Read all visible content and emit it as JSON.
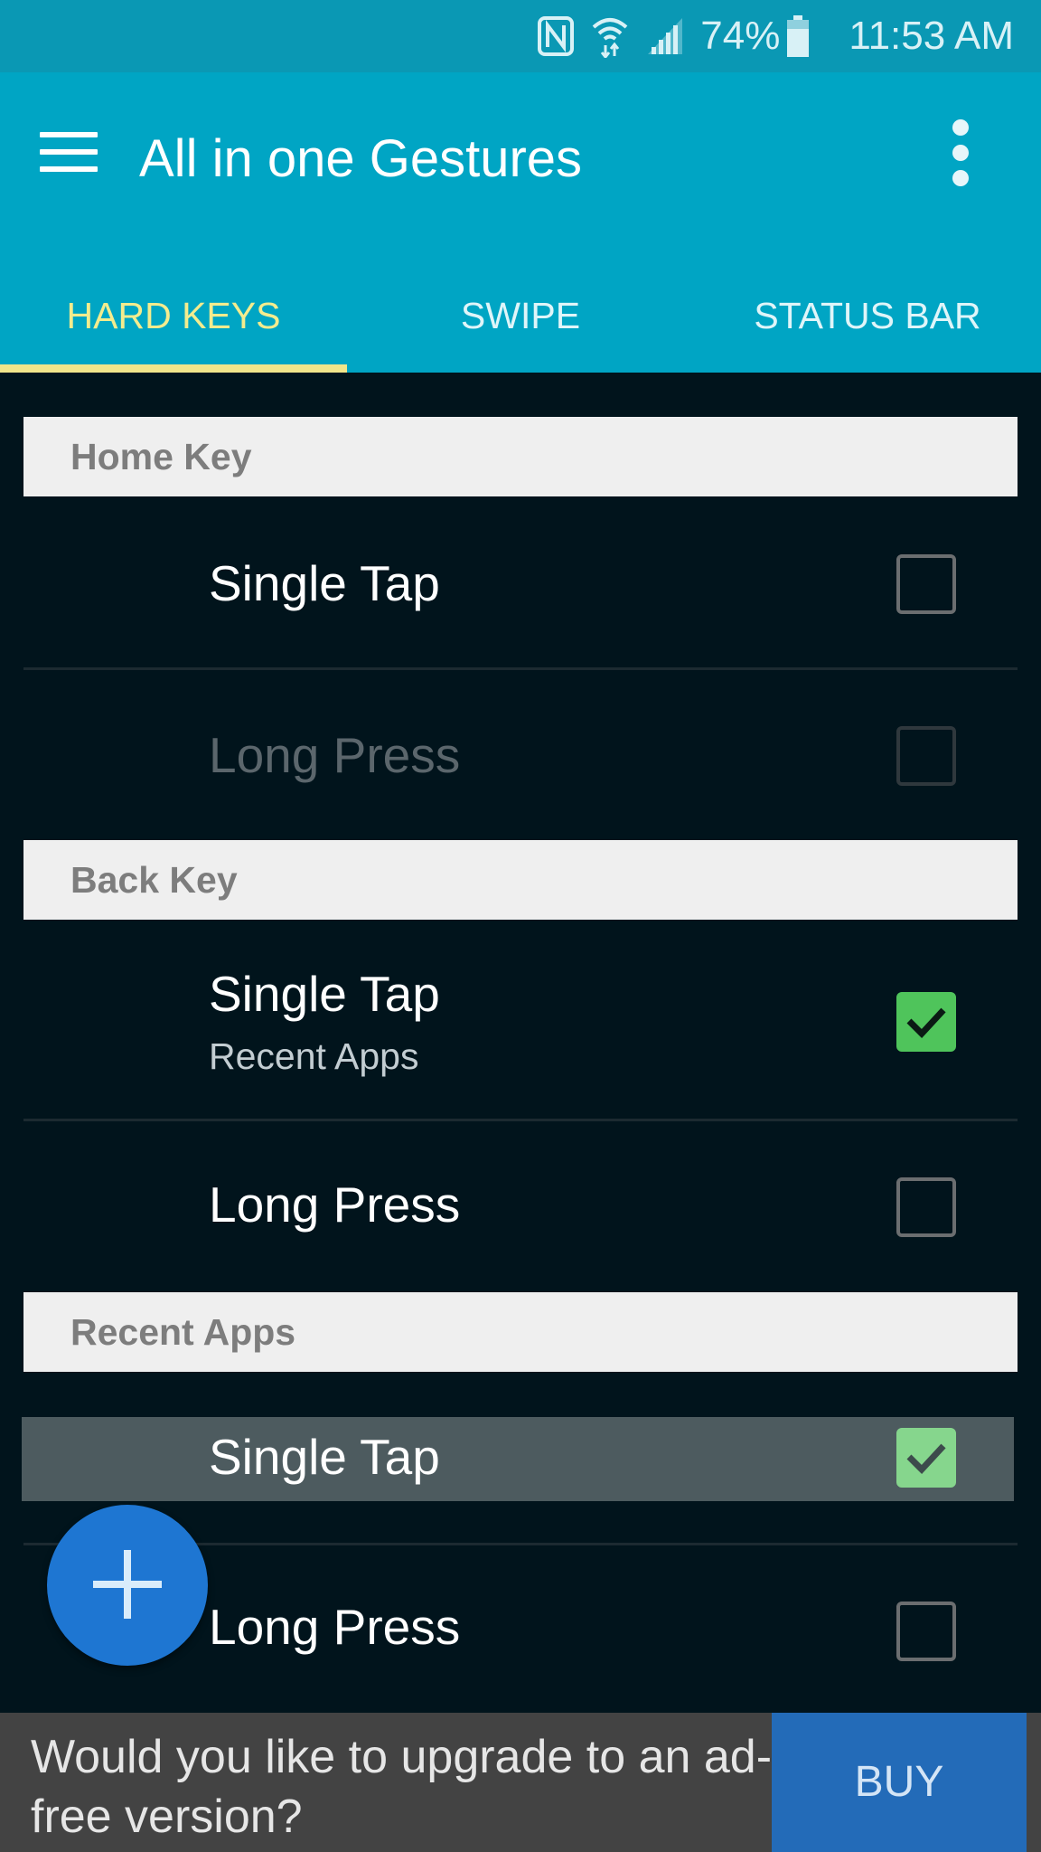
{
  "status_bar": {
    "icons": [
      "nfc-icon",
      "wifi-icon",
      "signal-icon",
      "battery-icon"
    ],
    "battery": "74%",
    "time": "11:53 AM"
  },
  "app_bar": {
    "title": "All in one Gestures",
    "menu_icon": "hamburger-menu-icon",
    "overflow_icon": "more-vert-icon"
  },
  "tabs": [
    {
      "label": "HARD KEYS",
      "active": true
    },
    {
      "label": "SWIPE",
      "active": false
    },
    {
      "label": "STATUS BAR",
      "active": false
    }
  ],
  "colors": {
    "app_bar": "#00a5c4",
    "active_tab": "#f3ec8e",
    "background": "#01141c",
    "checked": "#4fc45b",
    "fab": "#1e76d2",
    "buy": "#236bb8"
  },
  "sections": [
    {
      "header": "Home Key",
      "items": [
        {
          "label": "Single Tap",
          "checked": false,
          "enabled": true
        },
        {
          "label": "Long Press",
          "checked": false,
          "enabled": false
        }
      ]
    },
    {
      "header": "Back Key",
      "items": [
        {
          "label": "Single Tap",
          "sublabel": "Recent Apps",
          "checked": true,
          "enabled": true
        },
        {
          "label": "Long Press",
          "checked": false,
          "enabled": true
        }
      ]
    },
    {
      "header": "Recent Apps",
      "items": [
        {
          "label": "Single Tap",
          "checked": true,
          "enabled": true,
          "highlighted": true
        },
        {
          "label": "Long Press",
          "checked": false,
          "enabled": true
        }
      ]
    }
  ],
  "fab": {
    "icon": "plus-icon"
  },
  "banner": {
    "text": "Would you like to upgrade to an ad-free version?",
    "buy_label": "BUY"
  }
}
